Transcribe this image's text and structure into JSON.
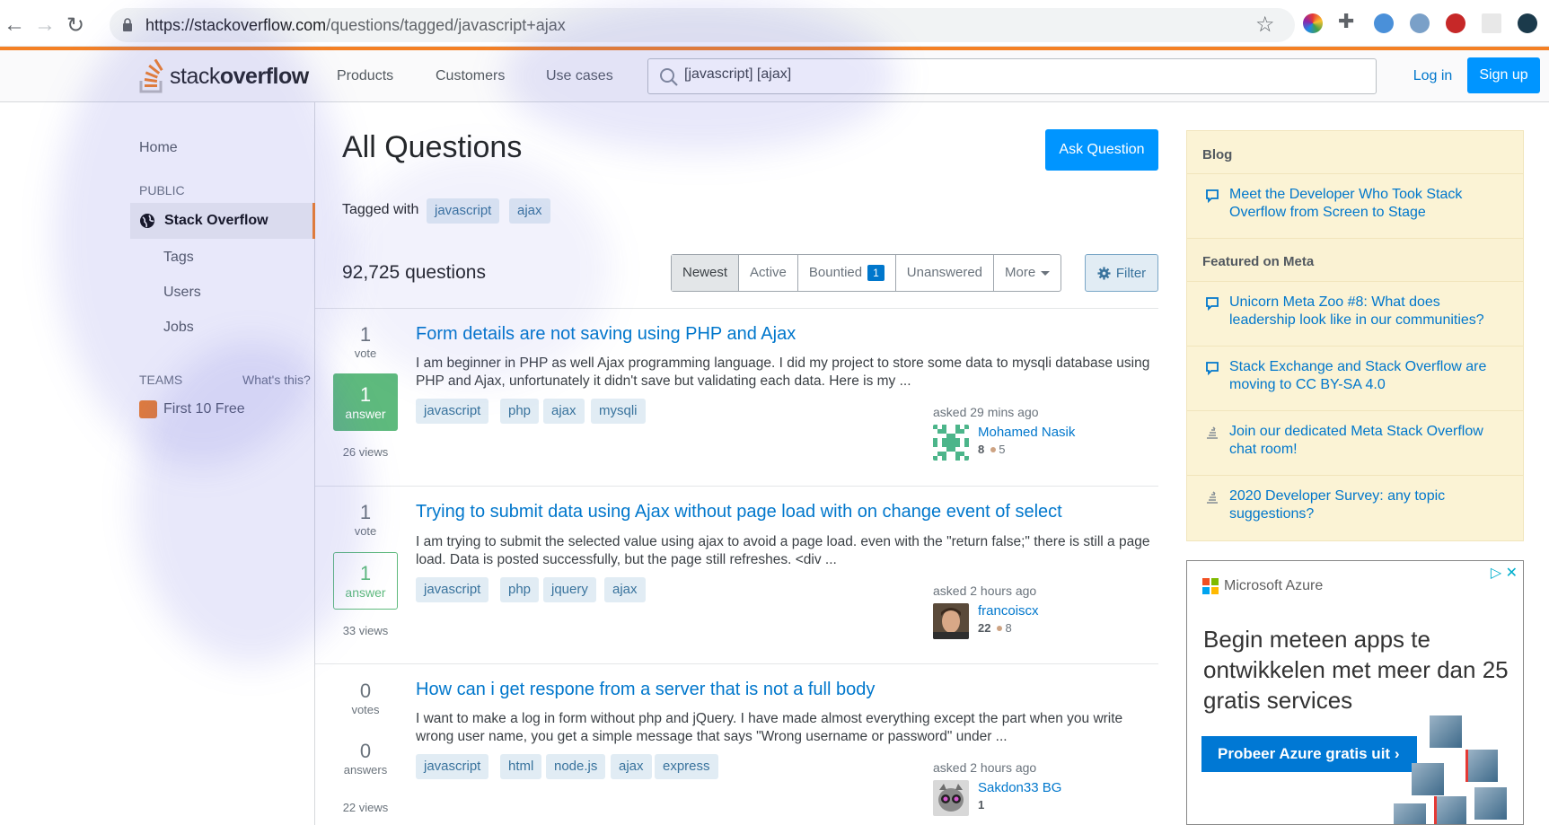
{
  "browser": {
    "url_host": "https://stackoverflow.com",
    "url_path": "/questions/tagged/javascript+ajax"
  },
  "header": {
    "logo_part1": "stack",
    "logo_part2": "overflow",
    "nav": [
      "Products",
      "Customers",
      "Use cases"
    ],
    "search_value": "[javascript] [ajax]",
    "login_label": "Log in",
    "signup_label": "Sign up",
    "accent": "#f48024"
  },
  "sidebar": {
    "home": "Home",
    "public_label": "PUBLIC",
    "active_item": "Stack Overflow",
    "items": [
      "Tags",
      "Users",
      "Jobs"
    ],
    "teams_label": "TEAMS",
    "whats_this": "What's this?",
    "teams_free": "First 10 Free"
  },
  "main": {
    "title": "All Questions",
    "ask_button": "Ask Question",
    "tagged_with": "Tagged with",
    "tagged_tags": [
      "javascript",
      "ajax"
    ],
    "question_count": "92,725 questions",
    "tabs": [
      "Newest",
      "Active",
      "Bountied",
      "Unanswered",
      "More"
    ],
    "bounty_count": "1",
    "filter_label": "Filter"
  },
  "questions": [
    {
      "votes": "1",
      "votes_label": "vote",
      "answers": "1",
      "answers_label": "answer",
      "views": "26 views",
      "title": "Form details are not saving using PHP and Ajax",
      "excerpt": "I am beginner in PHP as well Ajax programming language. I did my project to store some data to mysqli database using PHP and Ajax, unfortunately it didn't save but validating each data. Here is my ...",
      "tags": [
        "javascript",
        "php",
        "ajax",
        "mysqli"
      ],
      "asked": "asked 29 mins ago",
      "user": "Mohamed Nasik",
      "rep": "8",
      "bronze": "5"
    },
    {
      "votes": "1",
      "votes_label": "vote",
      "answers": "1",
      "answers_label": "answer",
      "views": "33 views",
      "title": "Trying to submit data using Ajax without page load with on change event of select",
      "excerpt": "I am trying to submit the selected value using ajax to avoid a page load. even with the \"return false;\" there is still a page load. Data is posted successfully, but the page still refreshes. <div ...",
      "tags": [
        "javascript",
        "php",
        "jquery",
        "ajax"
      ],
      "asked": "asked 2 hours ago",
      "user": "francoiscx",
      "rep": "22",
      "bronze": "8"
    },
    {
      "votes": "0",
      "votes_label": "votes",
      "answers": "0",
      "answers_label": "answers",
      "views": "22 views",
      "title": "How can i get respone from a server that is not a full body",
      "excerpt": "I want to make a log in form without php and jQuery. I have made almost everything except the part when you write wrong user name, you get a simple message that says \"Wrong username or password\" under ...",
      "tags": [
        "javascript",
        "html",
        "node.js",
        "ajax",
        "express"
      ],
      "asked": "asked 2 hours ago",
      "user": "Sakdon33 BG",
      "rep": "1"
    }
  ],
  "blog": {
    "heading": "Blog",
    "post": "Meet the Developer Who Took Stack Overflow from Screen to Stage",
    "meta_heading": "Featured on Meta",
    "meta_items": [
      "Unicorn Meta Zoo #8: What does leadership look like in our communities?",
      "Stack Exchange and Stack Overflow are moving to CC BY-SA 4.0",
      "Join our dedicated Meta Stack Overflow chat room!",
      "2020 Developer Survey: any topic suggestions?"
    ]
  },
  "ad": {
    "brand": "Microsoft Azure",
    "headline": "Begin meteen apps te ontwikkelen met meer dan 25 gratis services",
    "cta": "Probeer Azure gratis uit"
  }
}
